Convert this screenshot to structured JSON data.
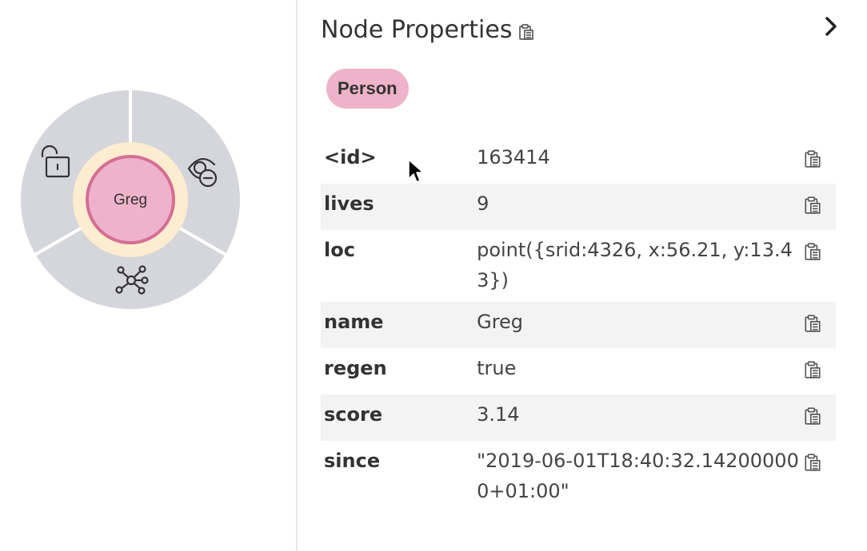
{
  "node": {
    "caption": "Greg",
    "menu_icons": [
      "unlock-icon",
      "hide-icon",
      "expand-icon"
    ],
    "colors": {
      "ring": "#d5d6db",
      "halo": "#fcecd0",
      "node_fill": "#eeb3c9",
      "node_stroke": "#d46e94"
    }
  },
  "panel": {
    "title": "Node Properties",
    "label": "Person",
    "properties": [
      {
        "key": "<id>",
        "value": "163414"
      },
      {
        "key": "lives",
        "value": "9"
      },
      {
        "key": "loc",
        "value": "point({srid:4326, x:56.21, y:13.43})"
      },
      {
        "key": "name",
        "value": "Greg"
      },
      {
        "key": "regen",
        "value": "true"
      },
      {
        "key": "score",
        "value": "3.14"
      },
      {
        "key": "since",
        "value": "\"2019-06-01T18:40:32.142000000+01:00\""
      }
    ]
  }
}
